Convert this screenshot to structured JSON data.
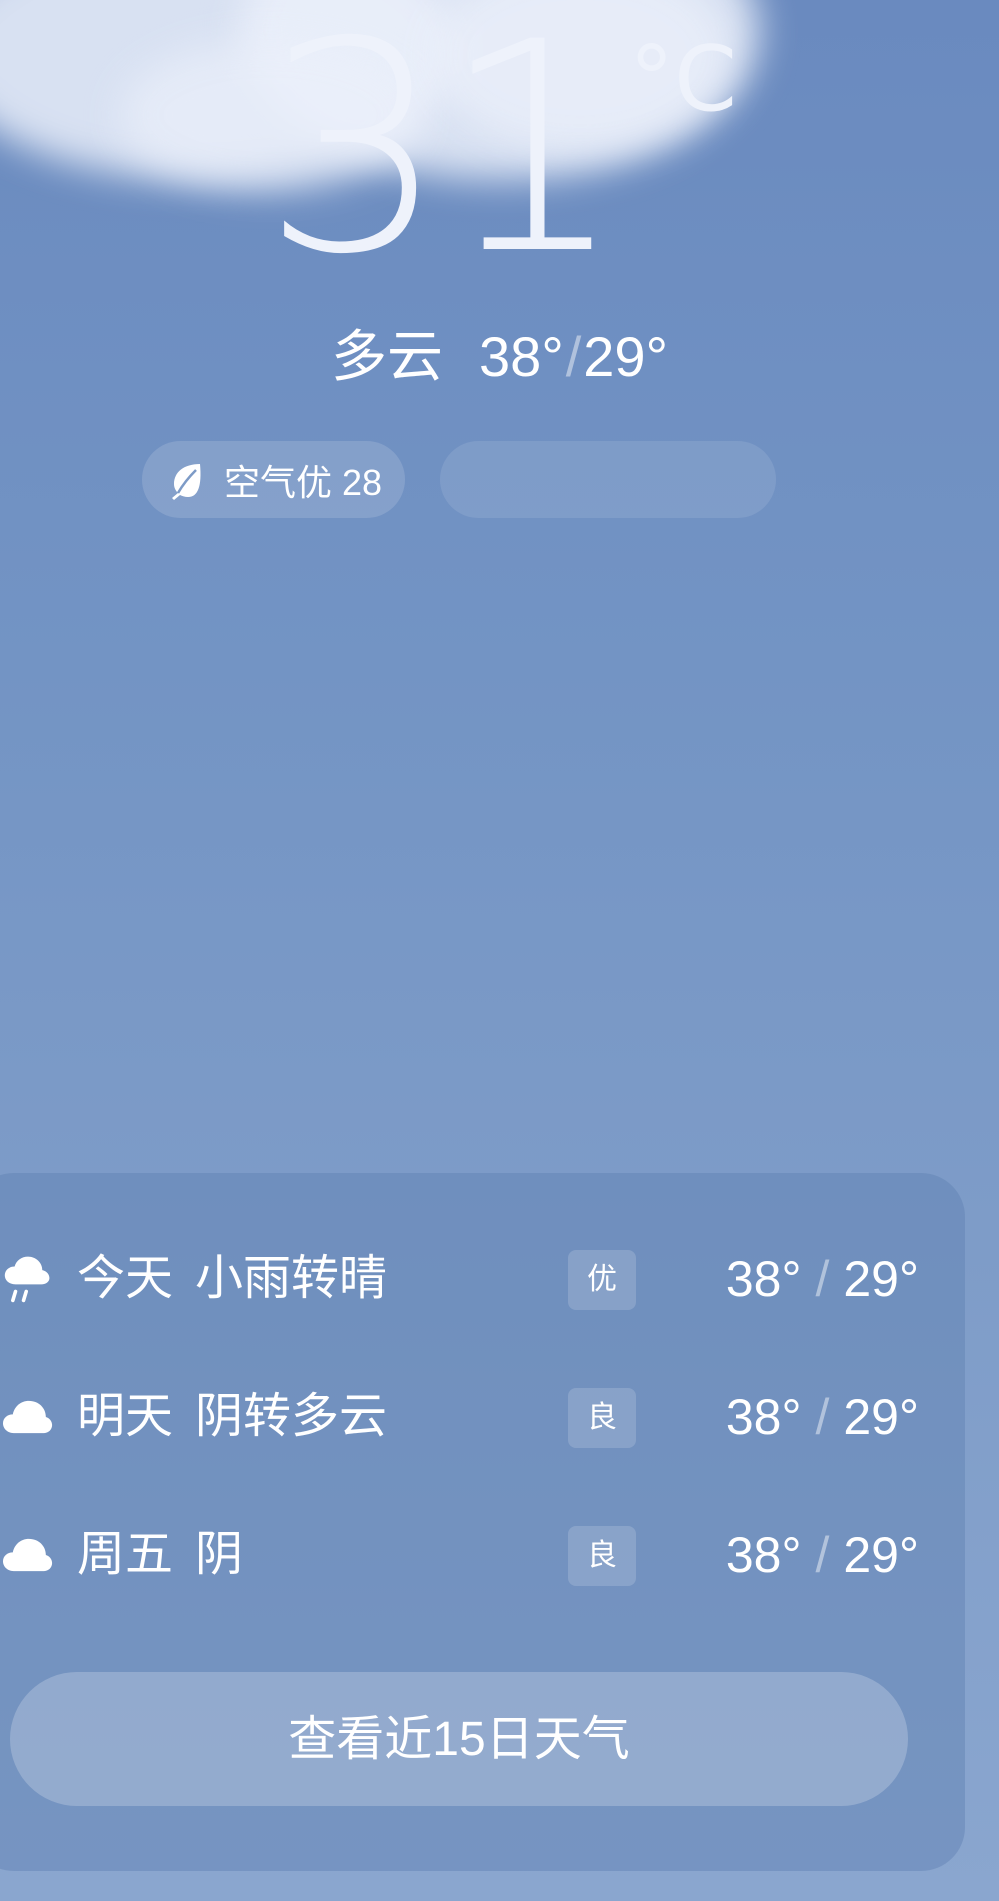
{
  "current": {
    "temperature": "31",
    "unit": "°C",
    "condition": "多云",
    "high": "38°",
    "low": "29°"
  },
  "chips": {
    "aqi_label": "空气优 28"
  },
  "forecast": [
    {
      "day": "今天",
      "condition": "小雨转晴",
      "aqi": "优",
      "high": "38°",
      "low": "29°",
      "icon": "light-rain-icon"
    },
    {
      "day": "明天",
      "condition": "阴转多云",
      "aqi": "良",
      "high": "38°",
      "low": "29°",
      "icon": "cloud-icon"
    },
    {
      "day": "周五",
      "condition": "阴",
      "aqi": "良",
      "high": "38°",
      "low": "29°",
      "icon": "cloud-icon"
    }
  ],
  "more_button": "查看近15日天气",
  "colors": {
    "sky_top": "#6a8abf",
    "sky_bottom": "#8aa6cf",
    "text": "#ffffff"
  }
}
